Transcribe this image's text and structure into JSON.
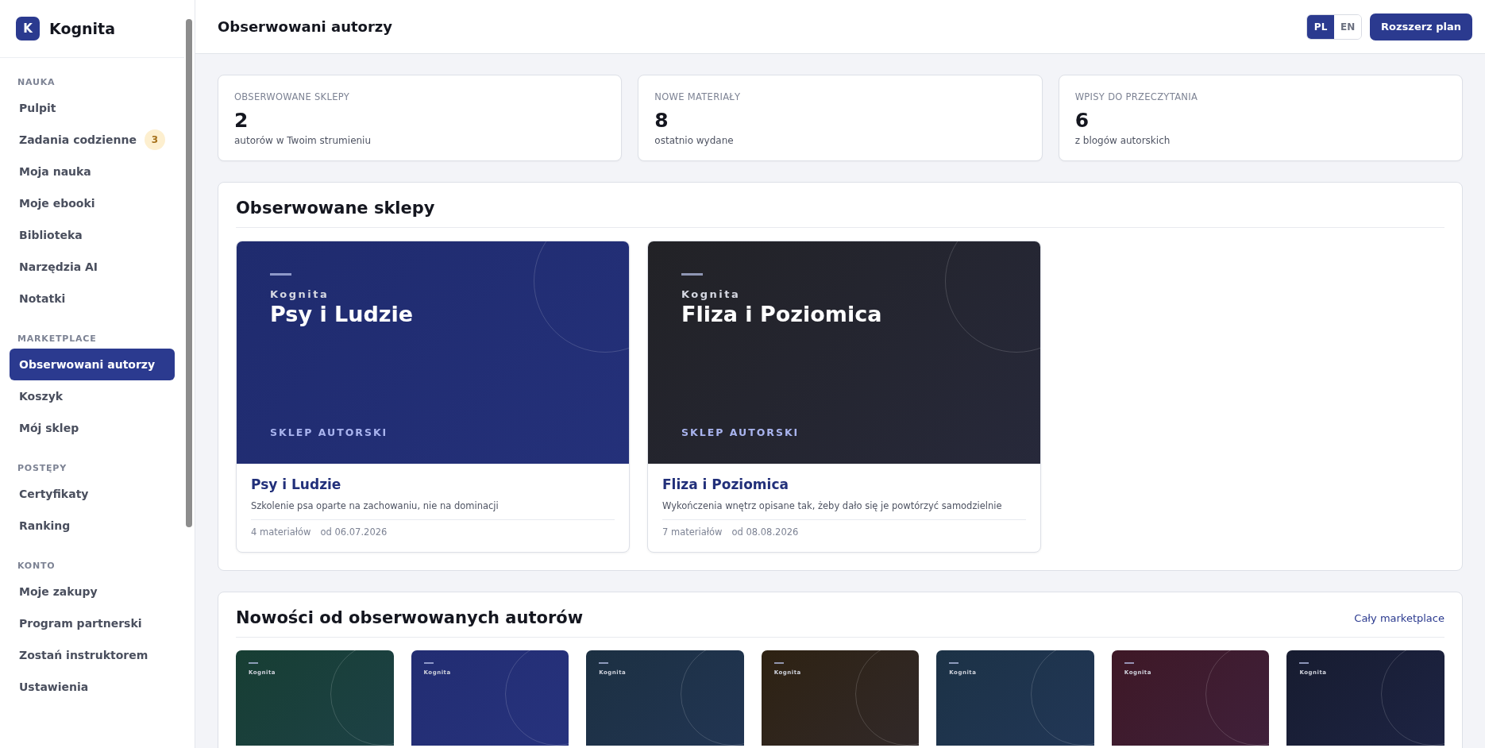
{
  "sidebar": {
    "brand": {
      "logo_letter": "K",
      "name": "Kognita"
    },
    "sections": [
      {
        "title": "NAUKA",
        "items": [
          {
            "label": "Pulpit",
            "selected": false
          },
          {
            "label": "Zadania codzienne",
            "selected": false,
            "badge": "3"
          },
          {
            "label": "Moja nauka",
            "selected": false
          },
          {
            "label": "Moje ebooki",
            "selected": false
          },
          {
            "label": "Biblioteka",
            "selected": false
          },
          {
            "label": "Narzędzia AI",
            "selected": false
          },
          {
            "label": "Notatki",
            "selected": false
          }
        ]
      },
      {
        "title": "MARKETPLACE",
        "items": [
          {
            "label": "Obserwowani autorzy",
            "selected": true
          },
          {
            "label": "Koszyk",
            "selected": false
          },
          {
            "label": "Mój sklep",
            "selected": false
          }
        ]
      },
      {
        "title": "POSTĘPY",
        "items": [
          {
            "label": "Certyfikaty",
            "selected": false
          },
          {
            "label": "Ranking",
            "selected": false
          }
        ]
      },
      {
        "title": "KONTO",
        "items": [
          {
            "label": "Moje zakupy",
            "selected": false
          },
          {
            "label": "Program partnerski",
            "selected": false
          },
          {
            "label": "Zostań instruktorem",
            "selected": false
          },
          {
            "label": "Ustawienia",
            "selected": false
          }
        ]
      }
    ]
  },
  "header": {
    "title": "Obserwowani autorzy",
    "languages": [
      {
        "label": "PL",
        "selected": true
      },
      {
        "label": "EN",
        "selected": false
      }
    ],
    "cta": "Rozszerz plan"
  },
  "stats": [
    {
      "label": "OBSERWOWANE SKLEPY",
      "value": "2",
      "caption": "autorów w Twoim strumieniu"
    },
    {
      "label": "NOWE MATERIAŁY",
      "value": "8",
      "caption": "ostatnio wydane"
    },
    {
      "label": "WPISY DO PRZECZYTANIA",
      "value": "6",
      "caption": "z blogów autorskich"
    }
  ],
  "followed_shops": {
    "title": "Obserwowane sklepy",
    "shops": [
      {
        "brand": "Kognita",
        "cover_title": "Psy i Ludzie",
        "tag": "SKLEP AUTORSKI",
        "color": "#1f2b6e",
        "name": "Psy i Ludzie",
        "description": "Szkolenie psa oparte na zachowaniu, nie na dominacji",
        "materials": "4 materiałów",
        "since": "od 06.07.2026"
      },
      {
        "brand": "Kognita",
        "cover_title": "Fliza i Poziomica",
        "tag": "SKLEP AUTORSKI",
        "color": "#222226",
        "name": "Fliza i Poziomica",
        "description": "Wykończenia wnętrz opisane tak, żeby dało się je powtórzyć samodzielnie",
        "materials": "7 materiałów",
        "since": "od 08.08.2026"
      }
    ]
  },
  "news": {
    "title": "Nowości od obserwowanych autorów",
    "link": "Cały marketplace",
    "items": [
      {
        "brand": "Kognita",
        "color": "#173e33"
      },
      {
        "brand": "Kognita",
        "color": "#222d72"
      },
      {
        "brand": "Kognita",
        "color": "#1c3042"
      },
      {
        "brand": "Kognita",
        "color": "#2e2212"
      },
      {
        "brand": "Kognita",
        "color": "#1c3246"
      },
      {
        "brand": "Kognita",
        "color": "#3e1826"
      },
      {
        "brand": "Kognita",
        "color": "#171c30"
      }
    ]
  }
}
